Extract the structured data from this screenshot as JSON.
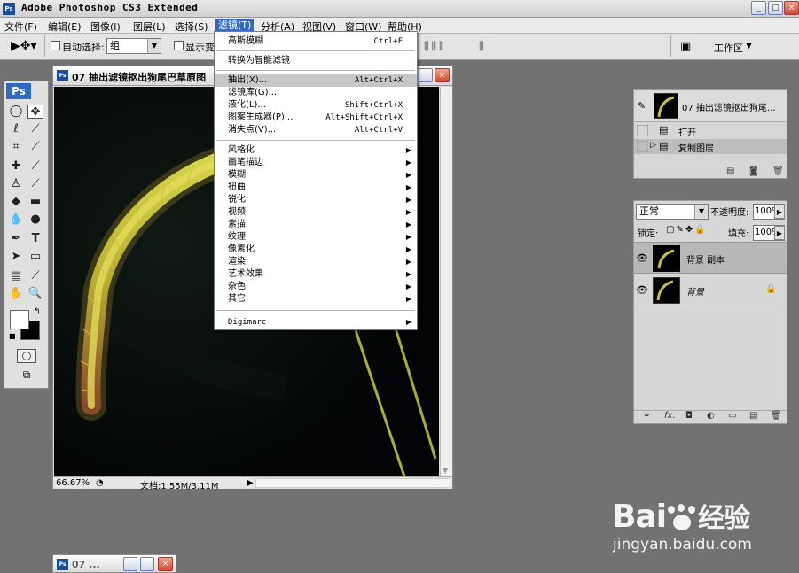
{
  "app": {
    "logo": "Ps",
    "title": "Adobe Photoshop CS3 Extended"
  },
  "window_controls": [
    "_",
    "□",
    "×"
  ],
  "menubar": [
    {
      "label": "文件(F)",
      "active": false
    },
    {
      "label": "编辑(E)",
      "active": false
    },
    {
      "label": "图像(I)",
      "active": false
    },
    {
      "label": "图层(L)",
      "active": false
    },
    {
      "label": "选择(S)",
      "active": false
    },
    {
      "label": "滤镜(T)",
      "active": true
    },
    {
      "label": "分析(A)",
      "active": false
    },
    {
      "label": "视图(V)",
      "active": false
    },
    {
      "label": "窗口(W)",
      "active": false
    },
    {
      "label": "帮助(H)",
      "active": false
    }
  ],
  "options_bar": {
    "auto_select_label": "自动选择:",
    "auto_select_value": "组",
    "show_transform_label": "显示变",
    "workspace_label": "工作区"
  },
  "toolbox": {
    "header": "Ps"
  },
  "document": {
    "title": "07 抽出滤镜抠出狗尾巴草原图",
    "zoom": "66.67%",
    "doc_info": "文档:1.55M/3.11M"
  },
  "filter_menu": {
    "items": [
      {
        "label": "高斯模糊",
        "shortcut": "Ctrl+F"
      },
      {
        "label": "转换为智能滤镜"
      },
      {
        "label": "抽出(X)...",
        "shortcut": "Alt+Ctrl+X",
        "highlight": true
      },
      {
        "label": "滤镜库(G)..."
      },
      {
        "label": "液化(L)...",
        "shortcut": "Shift+Ctrl+X"
      },
      {
        "label": "图案生成器(P)...",
        "shortcut": "Alt+Shift+Ctrl+X"
      },
      {
        "label": "消失点(V)...",
        "shortcut": "Alt+Ctrl+V"
      },
      {
        "label": "风格化",
        "submenu": true
      },
      {
        "label": "画笔描边",
        "submenu": true
      },
      {
        "label": "模糊",
        "submenu": true
      },
      {
        "label": "扭曲",
        "submenu": true
      },
      {
        "label": "锐化",
        "submenu": true
      },
      {
        "label": "视频",
        "submenu": true
      },
      {
        "label": "素描",
        "submenu": true
      },
      {
        "label": "纹理",
        "submenu": true
      },
      {
        "label": "像素化",
        "submenu": true
      },
      {
        "label": "渲染",
        "submenu": true
      },
      {
        "label": "艺术效果",
        "submenu": true
      },
      {
        "label": "杂色",
        "submenu": true
      },
      {
        "label": "其它",
        "submenu": true
      },
      {
        "label": "Digimarc",
        "submenu": true
      }
    ]
  },
  "history_panel": {
    "snapshot_label": "07 抽出滤镜抠出狗尾...",
    "steps": [
      {
        "label": "打开",
        "selected": false
      },
      {
        "label": "复制图层",
        "selected": true
      }
    ]
  },
  "layers_panel": {
    "blend_mode": "正常",
    "opacity_label": "不透明度:",
    "opacity_value": "100%",
    "lock_label": "锁定:",
    "fill_label": "填充:",
    "fill_value": "100%",
    "layers": [
      {
        "name": "背景 副本",
        "selected": true,
        "locked": false
      },
      {
        "name": "背景",
        "selected": false,
        "locked": true,
        "italic": true
      }
    ]
  },
  "minimized_doc": {
    "title": "07 ..."
  },
  "watermark": {
    "brand": "Bai",
    "brand_cn": "经验",
    "url": "jingyan.baidu.com"
  },
  "colors": {
    "menu_highlight": "#c7c7c7",
    "menubar_active": "#316ac5",
    "workspace_bg": "#727272",
    "grass_yellow": "#c8c23a"
  }
}
